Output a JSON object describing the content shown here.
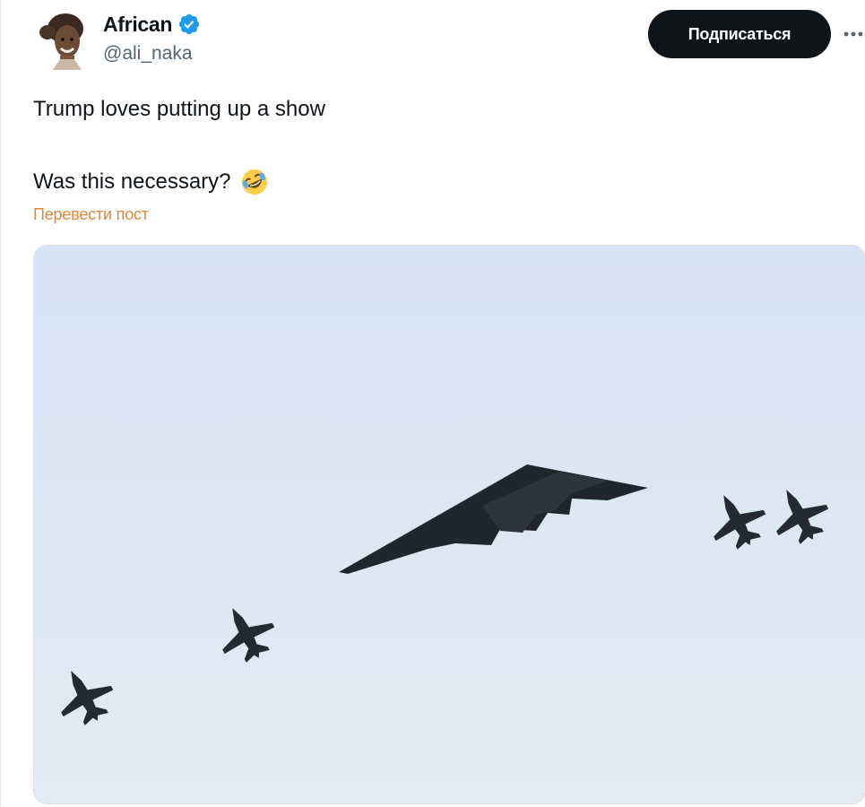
{
  "author": {
    "display_name": "African",
    "handle": "@ali_naka",
    "verified": true,
    "verified_color": "#1d9bf0"
  },
  "actions": {
    "subscribe_label": "Подписаться",
    "more_icon": "more-horizontal-icon"
  },
  "post": {
    "text_line_1": "Trump loves putting up a show",
    "text_line_2": "Was this necessary?",
    "emoji": "rolling-on-floor-laughing-emoji",
    "translate_label": "Перевести пост"
  },
  "media": {
    "description_icon": "photo-b2-bomber-with-four-fighter-jets"
  },
  "colors": {
    "text_primary": "#0f1419",
    "text_secondary": "#536471",
    "button_bg": "#0f1419",
    "translate_link": "#e0883a",
    "sky": "#dbe6f4"
  }
}
